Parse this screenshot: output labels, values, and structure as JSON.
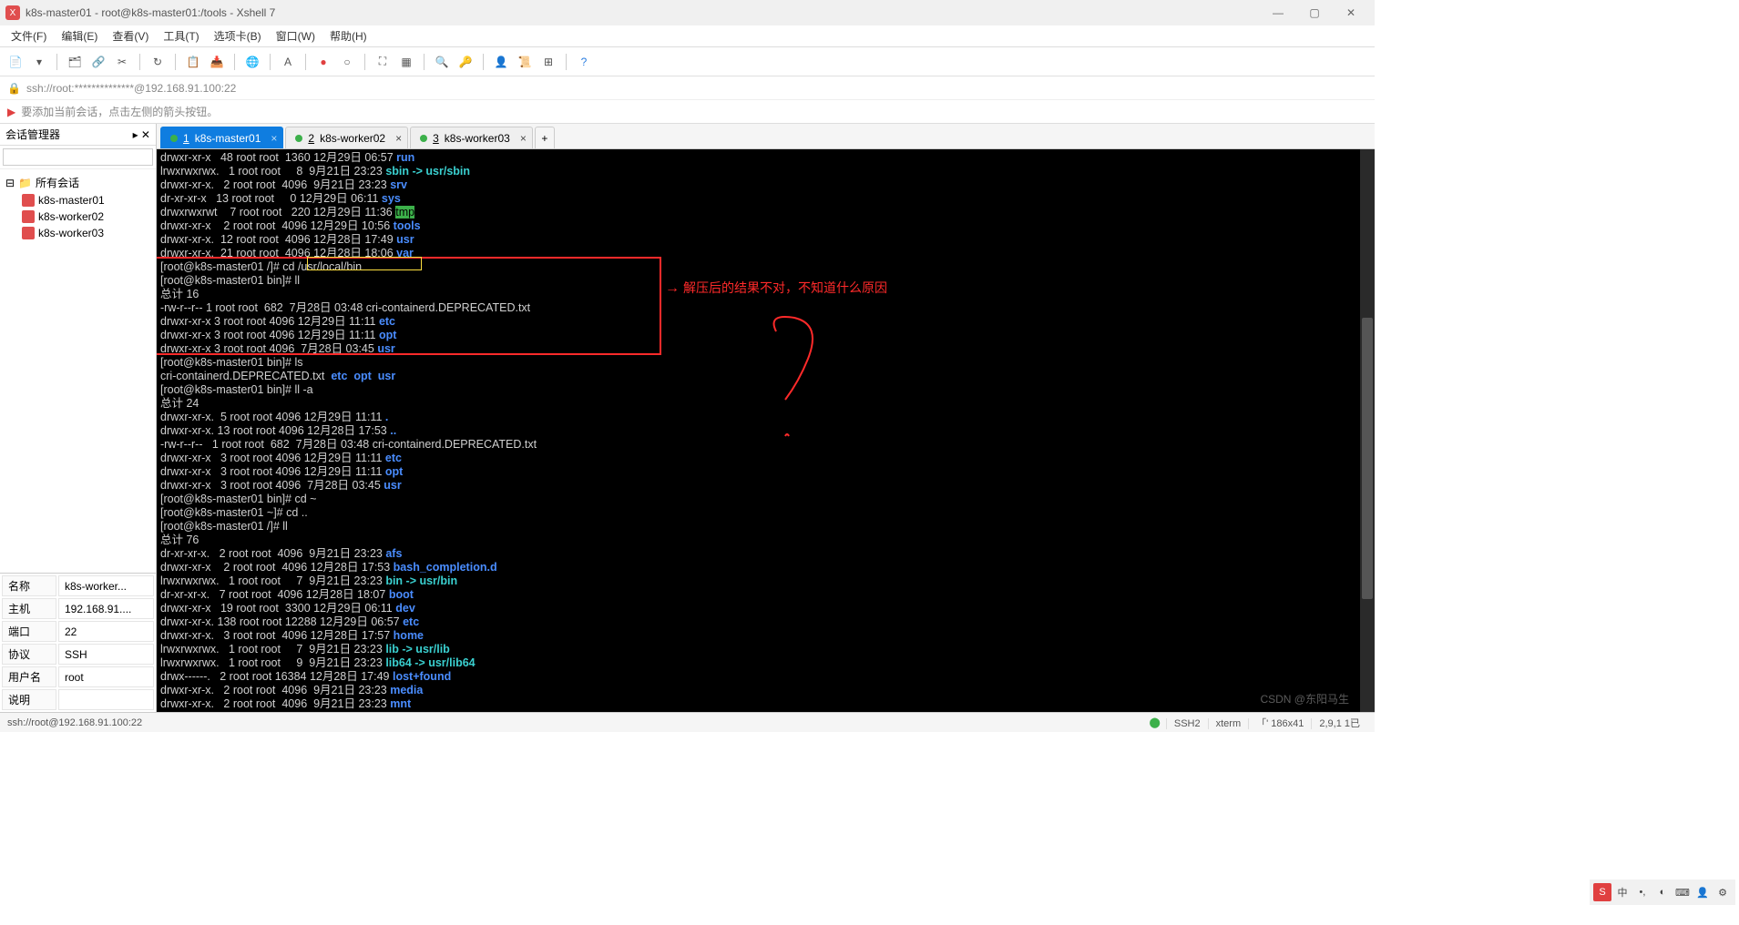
{
  "title": "k8s-master01 - root@k8s-master01:/tools - Xshell 7",
  "menus": [
    "文件(F)",
    "编辑(E)",
    "查看(V)",
    "工具(T)",
    "选项卡(B)",
    "窗口(W)",
    "帮助(H)"
  ],
  "addr": "ssh://root:**************@192.168.91.100:22",
  "hint": "要添加当前会话，点击左侧的箭头按钮。",
  "sidebar_title": "会话管理器",
  "tree_root": "所有会话",
  "sessions": [
    "k8s-master01",
    "k8s-worker02",
    "k8s-worker03"
  ],
  "props": [
    [
      "名称",
      "k8s-worker..."
    ],
    [
      "主机",
      "192.168.91...."
    ],
    [
      "端口",
      "22"
    ],
    [
      "协议",
      "SSH"
    ],
    [
      "用户名",
      "root"
    ],
    [
      "说明",
      ""
    ]
  ],
  "tabs": [
    {
      "num": "1",
      "label": "k8s-master01",
      "active": true
    },
    {
      "num": "2",
      "label": "k8s-worker02",
      "active": false
    },
    {
      "num": "3",
      "label": "k8s-worker03",
      "active": false
    }
  ],
  "annotation": "解压后的结果不对，不知道什么原因",
  "term_lines": [
    {
      "t": "drwxr-xr-x   48 root root  1360 12月29日 06:57 ",
      "dir": "run"
    },
    {
      "t": "lrwxrwxrwx.   1 root root     8  9月21日 23:23 ",
      "lnk": "sbin -> usr/sbin"
    },
    {
      "t": "drwxr-xr-x.   2 root root  4096  9月21日 23:23 ",
      "dir": "srv"
    },
    {
      "t": "dr-xr-xr-x   13 root root     0 12月29日 06:11 ",
      "dir": "sys"
    },
    {
      "t": "drwxrwxrwt    7 root root   220 12月29日 11:36 ",
      "tmp": "tmp"
    },
    {
      "t": "drwxr-xr-x    2 root root  4096 12月29日 10:56 ",
      "dir": "tools"
    },
    {
      "t": "drwxr-xr-x.  12 root root  4096 12月28日 17:49 ",
      "dir": "usr"
    },
    {
      "t": "drwxr-xr-x.  21 root root  4096 12月28日 18:06 ",
      "dir": "var"
    },
    {
      "p": "[root@k8s-master01 /]# ",
      "cmd": "cd /usr/local/bin"
    },
    {
      "p": "[root@k8s-master01 bin]# ",
      "cmd": "ll"
    },
    {
      "t": "总计 16"
    },
    {
      "t": "-rw-r--r-- 1 root root  682  7月28日 03:48 cri-containerd.DEPRECATED.txt"
    },
    {
      "t": "drwxr-xr-x 3 root root 4096 12月29日 11:11 ",
      "dir": "etc"
    },
    {
      "t": "drwxr-xr-x 3 root root 4096 12月29日 11:11 ",
      "dir": "opt"
    },
    {
      "t": "drwxr-xr-x 3 root root 4096  7月28日 03:45 ",
      "dir": "usr"
    },
    {
      "p": "[root@k8s-master01 bin]# ",
      "cmd": "ls"
    },
    {
      "t": "cri-containerd.DEPRECATED.txt  ",
      "dirs": [
        "etc",
        "opt",
        "usr"
      ]
    },
    {
      "p": "[root@k8s-master01 bin]# ",
      "cmd": "ll -a"
    },
    {
      "t": "总计 24"
    },
    {
      "t": "drwxr-xr-x.  5 root root 4096 12月29日 11:11 ",
      "dir": "."
    },
    {
      "t": "drwxr-xr-x. 13 root root 4096 12月28日 17:53 ",
      "dir": ".."
    },
    {
      "t": "-rw-r--r--   1 root root  682  7月28日 03:48 cri-containerd.DEPRECATED.txt"
    },
    {
      "t": "drwxr-xr-x   3 root root 4096 12月29日 11:11 ",
      "dir": "etc"
    },
    {
      "t": "drwxr-xr-x   3 root root 4096 12月29日 11:11 ",
      "dir": "opt"
    },
    {
      "t": "drwxr-xr-x   3 root root 4096  7月28日 03:45 ",
      "dir": "usr"
    },
    {
      "p": "[root@k8s-master01 bin]# ",
      "cmd": "cd ~"
    },
    {
      "p": "[root@k8s-master01 ~]# ",
      "cmd": "cd .."
    },
    {
      "p": "[root@k8s-master01 /]# ",
      "cmd": "ll"
    },
    {
      "t": "总计 76"
    },
    {
      "t": "dr-xr-xr-x.   2 root root  4096  9月21日 23:23 ",
      "dir": "afs"
    },
    {
      "t": "drwxr-xr-x    2 root root  4096 12月28日 17:53 ",
      "dir": "bash_completion.d"
    },
    {
      "t": "lrwxrwxrwx.   1 root root     7  9月21日 23:23 ",
      "lnk": "bin -> usr/bin"
    },
    {
      "t": "dr-xr-xr-x.   7 root root  4096 12月28日 18:07 ",
      "dir": "boot"
    },
    {
      "t": "drwxr-xr-x   19 root root  3300 12月29日 06:11 ",
      "dir": "dev"
    },
    {
      "t": "drwxr-xr-x. 138 root root 12288 12月29日 06:57 ",
      "dir": "etc"
    },
    {
      "t": "drwxr-xr-x.   3 root root  4096 12月28日 17:57 ",
      "dir": "home"
    },
    {
      "t": "lrwxrwxrwx.   1 root root     7  9月21日 23:23 ",
      "lnk": "lib -> usr/lib"
    },
    {
      "t": "lrwxrwxrwx.   1 root root     9  9月21日 23:23 ",
      "lnk": "lib64 -> usr/lib64"
    },
    {
      "t": "drwx------.   2 root root 16384 12月28日 17:49 ",
      "dir": "lost+found"
    },
    {
      "t": "drwxr-xr-x.   2 root root  4096  9月21日 23:23 ",
      "dir": "media"
    },
    {
      "t": "drwxr-xr-x.   2 root root  4096  9月21日 23:23 ",
      "dir": "mnt"
    }
  ],
  "status_left": "ssh://root@192.168.91.100:22",
  "status": [
    "SSH2",
    "xterm",
    "「' 186x41",
    "2,9,1 1已"
  ],
  "watermark": "CSDN @东阳马生"
}
